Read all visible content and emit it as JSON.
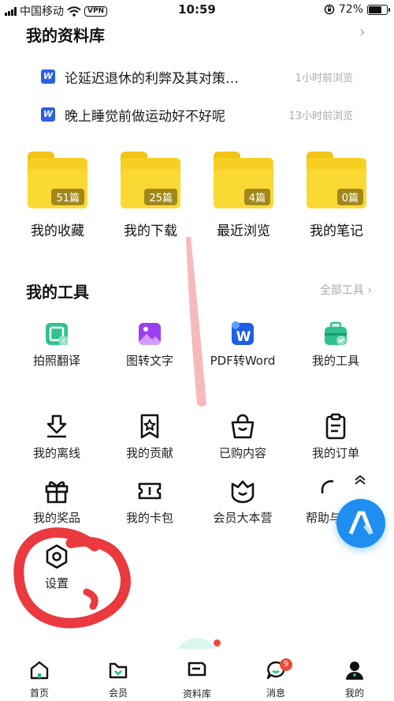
{
  "status_bar": {
    "carrier": "中国移动",
    "vpn": "VPN",
    "time": "10:59",
    "battery": "72%",
    "battery_level": 0.72
  },
  "library": {
    "title": "我的资料库",
    "recent": [
      {
        "icon": "word-doc-icon",
        "letter": "W",
        "title": "论延迟退休的利弊及其对策…",
        "time": "1小时前浏览"
      },
      {
        "icon": "word-doc-icon",
        "letter": "W",
        "title": "晚上睡觉前做运动好不好呢",
        "time": "13小时前浏览"
      }
    ],
    "folders": [
      {
        "label": "我的收藏",
        "count": "51篇"
      },
      {
        "label": "我的下载",
        "count": "25篇"
      },
      {
        "label": "最近浏览",
        "count": "4篇"
      },
      {
        "label": "我的笔记",
        "count": "0篇"
      }
    ]
  },
  "tools": {
    "title": "我的工具",
    "more": "全部工具 ›",
    "featured": [
      {
        "label": "拍照翻译",
        "icon": "photo-translate-icon"
      },
      {
        "label": "图转文字",
        "icon": "image-to-text-icon"
      },
      {
        "label": "PDF转Word",
        "icon": "pdf-to-word-icon"
      },
      {
        "label": "我的工具",
        "icon": "toolbox-icon"
      }
    ],
    "grid": [
      {
        "label": "我的离线",
        "icon": "offline-download-icon"
      },
      {
        "label": "我的贡献",
        "icon": "contribution-star-icon"
      },
      {
        "label": "已购内容",
        "icon": "shopping-bag-icon"
      },
      {
        "label": "我的订单",
        "icon": "order-clipboard-icon"
      },
      {
        "label": "我的奖品",
        "icon": "gift-icon"
      },
      {
        "label": "我的卡包",
        "icon": "ticket-icon"
      },
      {
        "label": "会员大本营",
        "icon": "member-heart-icon"
      },
      {
        "label": "帮助与",
        "icon": "headset-icon"
      },
      {
        "label": "设置",
        "icon": "settings-hexagon-icon"
      }
    ]
  },
  "tabbar": {
    "items": [
      {
        "label": "首页",
        "icon": "home-icon"
      },
      {
        "label": "会员",
        "icon": "member-icon"
      },
      {
        "label": "资料库",
        "icon": "library-icon"
      },
      {
        "label": "消息",
        "icon": "message-icon",
        "badge": "9"
      },
      {
        "label": "我的",
        "icon": "profile-icon"
      }
    ]
  },
  "colors": {
    "accent_green": "#22b88a",
    "folder_yellow": "#f7cf23",
    "word_blue": "#2b5fe6",
    "badge_red": "#f04a3a",
    "float_blue": "#1e8ff0",
    "annotation_red": "#e8242a"
  }
}
